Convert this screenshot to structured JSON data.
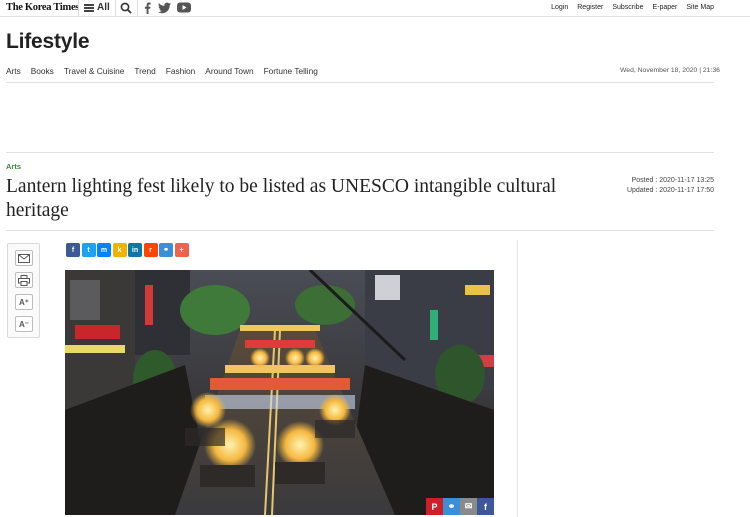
{
  "brand": {
    "logo": "The Korea Times",
    "menu_label": "All"
  },
  "icons": {
    "menu": "hamburger-icon",
    "search": "search-icon",
    "facebook": "facebook-icon",
    "twitter": "twitter-icon",
    "youtube": "youtube-icon"
  },
  "utility_links": [
    "Login",
    "Register",
    "Subscribe",
    "E-paper",
    "Site Map"
  ],
  "section": {
    "title": "Lifestyle",
    "nav": [
      "Arts",
      "Books",
      "Travel & Cuisine",
      "Trend",
      "Fashion",
      "Around Town",
      "Fortune Telling"
    ],
    "datetime": "Wed, November 18, 2020 | 21:36"
  },
  "article": {
    "category": "Arts",
    "headline": "Lantern lighting fest likely to be listed as UNESCO intangible cultural heritage",
    "posted": "Posted : 2020-11-17 13:25",
    "updated": "Updated : 2020-11-17 17:50"
  },
  "tools": [
    {
      "name": "email-icon",
      "glyph": "✉"
    },
    {
      "name": "print-icon",
      "glyph": "⎙"
    },
    {
      "name": "font-increase-icon",
      "glyph": "A⁺"
    },
    {
      "name": "font-decrease-icon",
      "glyph": "A⁻"
    }
  ],
  "share_buttons": [
    {
      "name": "facebook",
      "glyph": "f",
      "color": "#3b5998"
    },
    {
      "name": "twitter",
      "glyph": "t",
      "color": "#1da1f2"
    },
    {
      "name": "messenger",
      "glyph": "m",
      "color": "#0084ff"
    },
    {
      "name": "kakaostory",
      "glyph": "k",
      "color": "#f0b400"
    },
    {
      "name": "linkedin",
      "glyph": "in",
      "color": "#0e76a8"
    },
    {
      "name": "reddit",
      "glyph": "r",
      "color": "#ff4500"
    },
    {
      "name": "link",
      "glyph": "⚭",
      "color": "#3a8fd6"
    },
    {
      "name": "more",
      "glyph": "+",
      "color": "#f0634a"
    }
  ],
  "photo_share": [
    {
      "name": "pinterest",
      "glyph": "P",
      "color": "#cb2027"
    },
    {
      "name": "link",
      "glyph": "⚭",
      "color": "#3a8fd6"
    },
    {
      "name": "email",
      "glyph": "✉",
      "color": "#8a8a8a"
    },
    {
      "name": "facebook",
      "glyph": "f",
      "color": "#3b5998"
    }
  ],
  "colors": {
    "category_green": "#3a8a3a",
    "text_dark": "#222222",
    "rule_gray": "#e2e2e2"
  }
}
